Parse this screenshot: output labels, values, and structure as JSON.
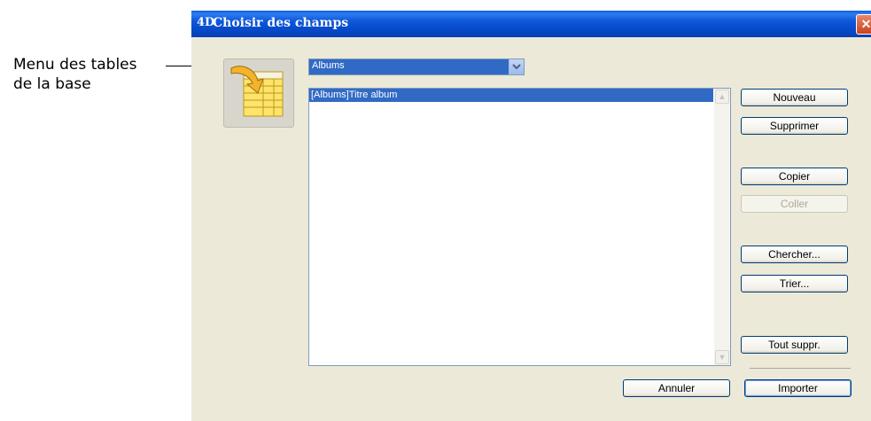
{
  "callout": {
    "line1": "Menu des tables",
    "line2": "de la base"
  },
  "window": {
    "app_logo": "4D",
    "title": "Choisir des champs",
    "close_glyph": "✕"
  },
  "table_menu": {
    "selected": "Albums",
    "arrow_glyph": "⌄"
  },
  "field_list": {
    "items": [
      "[Albums]Titre album"
    ],
    "scroll_up_glyph": "▲",
    "scroll_down_glyph": "▼"
  },
  "buttons": {
    "nouveau": "Nouveau",
    "supprimer": "Supprimer",
    "copier": "Copier",
    "coller": "Coller",
    "chercher": "Chercher...",
    "trier": "Trier...",
    "tout_suppr": "Tout suppr.",
    "annuler": "Annuler",
    "importer": "Importer"
  },
  "colors": {
    "title_bar": "#0546c5",
    "selection": "#316ac5",
    "dialog_bg": "#ece9d8"
  }
}
